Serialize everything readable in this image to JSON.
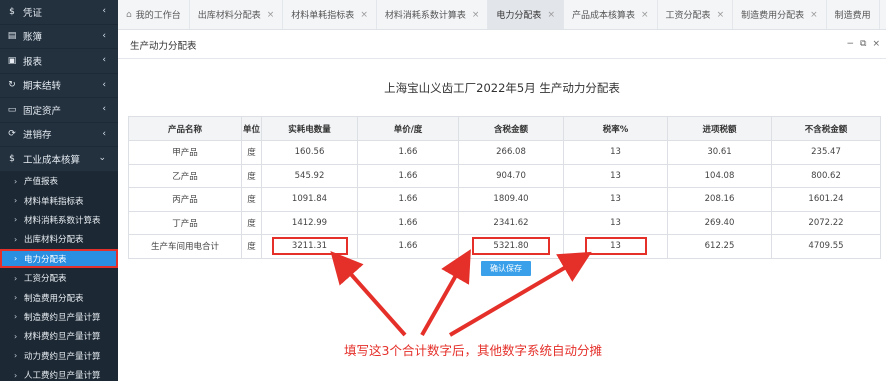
{
  "sidebar": {
    "main_items": [
      {
        "label": "凭证",
        "icon": "dollar-icon"
      },
      {
        "label": "账簿",
        "icon": "book-icon"
      },
      {
        "label": "报表",
        "icon": "report-icon"
      },
      {
        "label": "期末结转",
        "icon": "refresh-icon"
      },
      {
        "label": "固定资产",
        "icon": "monitor-icon"
      },
      {
        "label": "进销存",
        "icon": "cycle-icon"
      },
      {
        "label": "工业成本核算",
        "icon": "dollar-icon"
      }
    ],
    "sub_items": [
      "产值报表",
      "材料单耗指标表",
      "材料消耗系数计算表",
      "出库材料分配表",
      "电力分配表",
      "工资分配表",
      "制造费用分配表",
      "制造费约旦产量计算",
      "材料费约旦产量计算",
      "动力费约旦产量计算",
      "人工费约旦产量计算"
    ],
    "active_sub": "电力分配表"
  },
  "tabs": [
    {
      "label": "我的工作台",
      "closable": false
    },
    {
      "label": "出库材料分配表",
      "closable": true
    },
    {
      "label": "材料单耗指标表",
      "closable": true
    },
    {
      "label": "材料消耗系数计算表",
      "closable": true
    },
    {
      "label": "电力分配表",
      "closable": true,
      "active": true
    },
    {
      "label": "产品成本核算表",
      "closable": true
    },
    {
      "label": "工资分配表",
      "closable": true
    },
    {
      "label": "制造费用分配表",
      "closable": true
    },
    {
      "label": "制造费用",
      "closable": false
    }
  ],
  "panel": {
    "title": "生产动力分配表",
    "report_title": "上海宝山义齿工厂2022年5月 生产动力分配表"
  },
  "table": {
    "headers": [
      "产品名称",
      "单位",
      "实耗电数量",
      "单价/度",
      "含税金额",
      "税率%",
      "进项税额",
      "不含税金额"
    ],
    "rows": [
      [
        "甲产品",
        "度",
        "160.56",
        "1.66",
        "266.08",
        "13",
        "30.61",
        "235.47"
      ],
      [
        "乙产品",
        "度",
        "545.92",
        "1.66",
        "904.70",
        "13",
        "104.08",
        "800.62"
      ],
      [
        "丙产品",
        "度",
        "1091.84",
        "1.66",
        "1809.40",
        "13",
        "208.16",
        "1601.24"
      ],
      [
        "丁产品",
        "度",
        "1412.99",
        "1.66",
        "2341.62",
        "13",
        "269.40",
        "2072.22"
      ],
      [
        "生产车间用电合计",
        "度",
        "3211.31",
        "1.66",
        "5321.80",
        "13",
        "612.25",
        "4709.55"
      ]
    ]
  },
  "confirm_button": "确认保存",
  "annotation": "填写这3个合计数字后，其他数字系统自动分摊",
  "colors": {
    "sidebar_bg": "#23313f",
    "active_item": "#2a8fe0",
    "highlight_red": "#e5302a",
    "button_blue": "#3aa0ea"
  }
}
